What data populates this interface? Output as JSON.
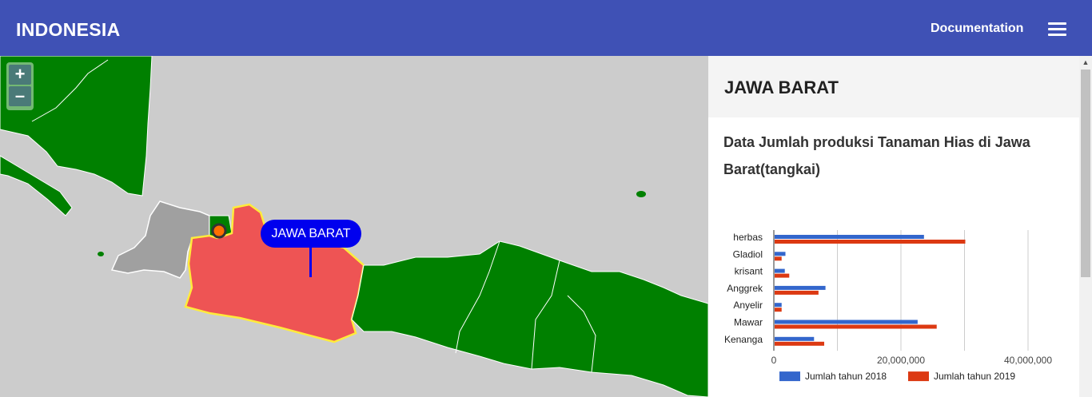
{
  "header": {
    "brand": "INDONESIA",
    "doc_label": "Documentation",
    "menu_icon": "hamburger-menu-icon"
  },
  "map": {
    "zoom_in": "+",
    "zoom_out": "–",
    "tooltip": "JAWA BARAT",
    "colors": {
      "water": "#cccccc",
      "land": "#008000",
      "selected": "#ee5454",
      "selected_border": "#ffeb3b",
      "neighbor": "#a0a0a0",
      "marker": "#ff6f00",
      "tooltip_bg": "#0000ee"
    }
  },
  "panel": {
    "title": "JAWA BARAT",
    "subtitle": "Data Jumlah produksi Tanaman Hias di Jawa Barat(tangkai)"
  },
  "chart_data": {
    "type": "bar",
    "orientation": "horizontal",
    "categories": [
      "herbas",
      "Gladiol",
      "krisant",
      "Anggrek",
      "Anyelir",
      "Mawar",
      "Kenanga"
    ],
    "series": [
      {
        "name": "Jumlah tahun 2018",
        "color": "#3366cc",
        "values": [
          23500000,
          1700000,
          1600000,
          8000000,
          1100000,
          22500000,
          6200000
        ]
      },
      {
        "name": "Jumlah tahun 2019",
        "color": "#dc3912",
        "values": [
          30000000,
          1100000,
          2300000,
          6900000,
          1100000,
          25500000,
          7800000
        ]
      }
    ],
    "xlim": [
      0,
      40000000
    ],
    "xticks": [
      "0",
      "20,000,000",
      "40,000,000"
    ],
    "grid": true,
    "legend_position": "bottom"
  }
}
